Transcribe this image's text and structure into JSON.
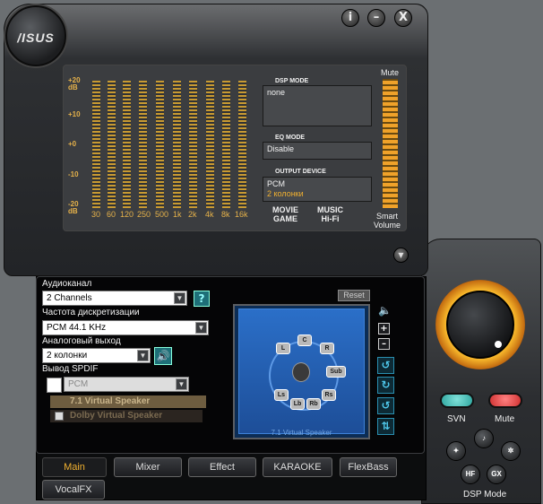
{
  "header": {
    "brand": "/ISUS",
    "buttons": [
      {
        "label": "i",
        "icon": "info-icon"
      },
      {
        "label": "–",
        "icon": "minimize-icon"
      },
      {
        "label": "X",
        "icon": "close-icon"
      }
    ]
  },
  "eq": {
    "db_labels": [
      "+20\ndB",
      "+10",
      "+0",
      "-10",
      "-20\ndB"
    ],
    "freqs": [
      "30",
      "60",
      "120",
      "250",
      "500",
      "1k",
      "2k",
      "4k",
      "8k",
      "16k"
    ],
    "dsp_mode_title": "DSP MODE",
    "dsp_mode_value": "none",
    "eq_mode_title": "EQ MODE",
    "eq_mode_value": "Disable",
    "output_title": "OUTPUT DEVICE",
    "output_line1": "PCM",
    "output_line2": "2 колонки",
    "preset_movie": "MOVIE",
    "preset_game": "GAME",
    "preset_music": "MUSIC",
    "preset_hifi": "Hi-Fi",
    "mute_label": "Mute",
    "smart_volume_line1": "Smart",
    "smart_volume_line2": "Volume"
  },
  "settings": {
    "channel_label": "Аудиоканал",
    "channel_value": "2 Channels",
    "sample_label": "Частота дискретизации",
    "sample_value": "PCM 44.1 KHz",
    "analog_label": "Аналоговый выход",
    "analog_value": "2 колонки",
    "spdif_label": "Вывод SPDIF",
    "spdif_value": "PCM",
    "virtual_option1": "7.1 Virtual Speaker",
    "virtual_option2": "Dolby Virtual Speaker",
    "reset_label": "Reset",
    "stage_caption": "7.1 Virtual Speaker",
    "speakers": [
      "C",
      "L",
      "R",
      "Sub",
      "Ls",
      "Rs",
      "Lb",
      "Rb"
    ]
  },
  "tabs": {
    "main": "Main",
    "mixer": "Mixer",
    "effect": "Effect",
    "karaoke": "KARAOKE",
    "flexbass": "FlexBass",
    "vocalfx": "VocalFX"
  },
  "right": {
    "svn_label": "SVN",
    "mute_label": "Mute",
    "dsp_mode_label": "DSP Mode",
    "hf_label": "HF",
    "gx_label": "GX"
  },
  "colors": {
    "accent": "#f0a22a",
    "stage_blue": "#2b6fc8",
    "svn_green": "#2fa7a0",
    "mute_red": "#d03030"
  }
}
